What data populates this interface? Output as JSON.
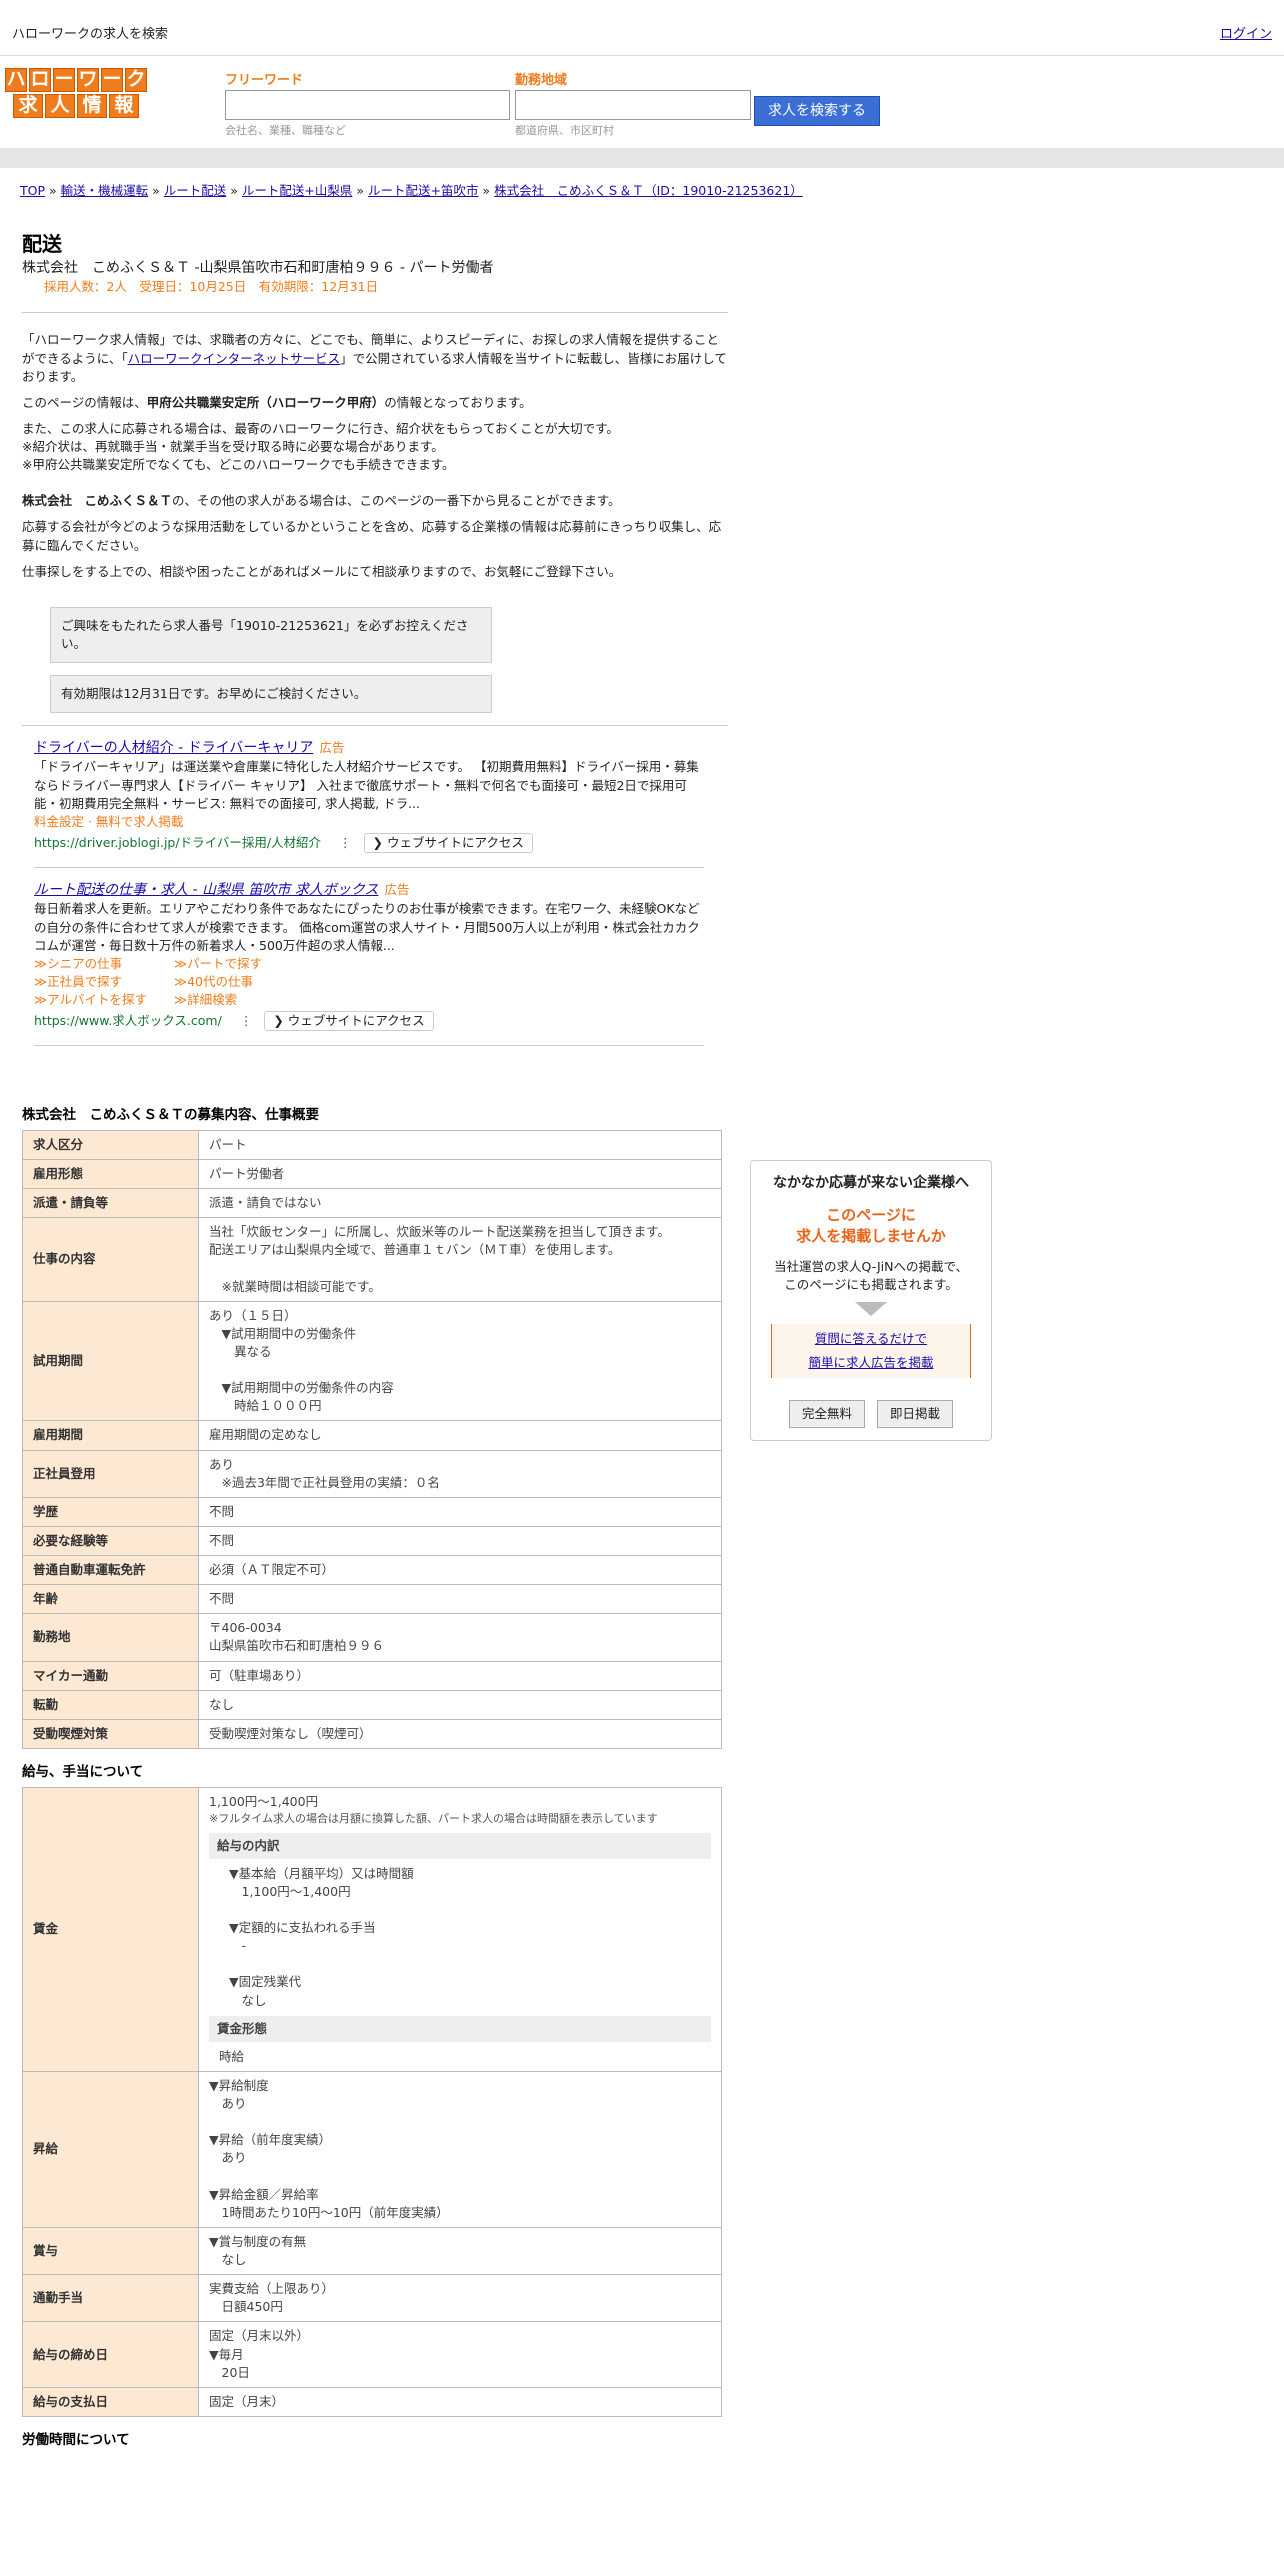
{
  "header": {
    "top_text": "ハローワークの求人を検索",
    "login": "ログイン",
    "logo_row1": [
      "ハ",
      "ロ",
      "ー",
      "ワ",
      "ー",
      "ク"
    ],
    "logo_row2": [
      "求",
      "人",
      "情",
      "報"
    ],
    "free_word_label": "フリーワード",
    "free_word_placeholder": "会社名、業種、職種など",
    "area_label": "勤務地域",
    "area_placeholder": "都道府県、市区町村",
    "search_button": "求人を検索する"
  },
  "breadcrumb": [
    "TOP",
    "輸送・機械運転",
    "ルート配送",
    "ルート配送+山梨県",
    "ルート配送+笛吹市",
    "株式会社　こめふくＳ＆Ｔ（ID：19010-21253621）"
  ],
  "job": {
    "title": "配送",
    "subtitle": "株式会社　こめふくＳ＆Ｔ -山梨県笛吹市石和町唐柏９９６ - パート労働者",
    "meta": "採用人数：2人　受理日：10月25日　有効期限：12月31日"
  },
  "intro": {
    "p1a": "「ハローワーク求人情報」では、求職者の方々に、どこでも、簡単に、よりスピーディに、お探しの求人情報を提供することができるように、「",
    "p1link": "ハローワークインターネットサービス",
    "p1b": "」で公開されている求人情報を当サイトに転載し、皆様にお届けしております。",
    "p2a": "このページの情報は、",
    "p2b": "甲府公共職業安定所（ハローワーク甲府）",
    "p2c": "の情報となっております。",
    "p3": [
      "また、この求人に応募される場合は、最寄のハローワークに行き、紹介状をもらっておくことが大切です。",
      "※紹介状は、再就職手当・就業手当を受け取る時に必要な場合があります。",
      "※甲府公共職業安定所でなくても、どこのハローワークでも手続きできます。"
    ],
    "p4a": "株式会社　こめふくＳ＆Ｔ",
    "p4b": "の、その他の求人がある場合は、このページの一番下から見ることができます。",
    "p5": "応募する会社が今どのような採用活動をしているかということを含め、応募する企業様の情報は応募前にきっちり収集し、応募に臨んでください。",
    "p6": "仕事探しをする上での、相談や困ったことがあればメールにて相談承りますので、お気軽にご登録下さい。",
    "note1": "ご興味をもたれたら求人番号「19010-21253621」を必ずお控えください。",
    "note2": "有効期限は12月31日です。お早めにご検討ください。"
  },
  "ads": [
    {
      "title": "ドライバーの人材紹介 - ドライバーキャリア",
      "tag": "広告",
      "desc": "「ドライバーキャリア」は運送業や倉庫業に特化した人材紹介サービスです。 【初期費用無料】ドライバー採用・募集ならドライバー専門求人【ドライバー キャリア】 入社まで徹底サポート・無料で何名でも面接可・最短2日で採用可能・初期費用完全無料・サービス: 無料での面接可, 求人掲載, ドラ...",
      "extra": "料金設定 · 無料で求人掲載",
      "url": "https://driver.joblogi.jp/ドライバー採用/人材紹介",
      "button": "❯ ウェブサイトにアクセス"
    },
    {
      "title": "ルート配送の仕事・求人 - 山梨県 笛吹市 求人ボックス",
      "tag": "広告",
      "desc": "毎日新着求人を更新。エリアやこだわり条件であなたにぴったりのお仕事が検索できます。在宅ワーク、未経験OKなどの自分の条件に合わせて求人が検索できます。 価格com運営の求人サイト・月間500万人以上が利用・株式会社カカクコムが運営・毎日数十万件の新着求人・500万件超の求人情報...",
      "links": [
        "≫シニアの仕事",
        "≫パートで探す",
        "≫正社員で探す",
        "≫40代の仕事",
        "≫アルバイトを探す",
        "≫詳細検索"
      ],
      "url": "https://www.求人ボックス.com/",
      "button": "❯ ウェブサイトにアクセス"
    }
  ],
  "sections": {
    "overview_title": "株式会社　こめふくＳ＆Ｔの募集内容、仕事概要",
    "overview": [
      {
        "k": "求人区分",
        "v": "パート"
      },
      {
        "k": "雇用形態",
        "v": "パート労働者"
      },
      {
        "k": "派遣・請負等",
        "v": "派遣・請負ではない"
      },
      {
        "k": "仕事の内容",
        "v": "当社「炊飯センター」に所属し、炊飯米等のルート配送業務を担当して頂きます。\n配送エリアは山梨県内全域で、普通車１ｔバン（ＭＴ車）を使用します。\n\n　※就業時間は相談可能です。"
      },
      {
        "k": "試用期間",
        "v": "あり（１５日）\n　▼試用期間中の労働条件\n　　異なる\n\n　▼試用期間中の労働条件の内容\n　　時給１０００円"
      },
      {
        "k": "雇用期間",
        "v": "雇用期間の定めなし"
      },
      {
        "k": "正社員登用",
        "v": "あり\n　※過去3年間で正社員登用の実績：０名"
      },
      {
        "k": "学歴",
        "v": "不問"
      },
      {
        "k": "必要な経験等",
        "v": "不問"
      },
      {
        "k": "普通自動車運転免許",
        "v": "必須（ＡＴ限定不可）"
      },
      {
        "k": "年齢",
        "v": "不問"
      },
      {
        "k": "勤務地",
        "v": "〒406-0034\n山梨県笛吹市石和町唐柏９９６"
      },
      {
        "k": "マイカー通勤",
        "v": "可（駐車場あり）"
      },
      {
        "k": "転勤",
        "v": "なし"
      },
      {
        "k": "受動喫煙対策",
        "v": "受動喫煙対策なし（喫煙可）"
      }
    ],
    "salary_title": "給与、手当について",
    "wage": {
      "k": "賃金",
      "range": "1,100円〜1,400円",
      "note": "※フルタイム求人の場合は月額に換算した額、パート求人の場合は時間額を表示しています",
      "breakdown_title": "給与の内訳",
      "breakdown": "▼基本給（月額平均）又は時間額\n　1,100円〜1,400円\n\n▼定額的に支払われる手当\n　-\n\n▼固定残業代\n　なし",
      "form_title": "賃金形態",
      "form": "時給"
    },
    "salary_rows": [
      {
        "k": "昇給",
        "v": "▼昇給制度\n　あり\n\n▼昇給（前年度実績）\n　あり\n\n▼昇給金額／昇給率\n　1時間あたり10円〜10円（前年度実績）"
      },
      {
        "k": "賞与",
        "v": "▼賞与制度の有無\n　なし"
      },
      {
        "k": "通勤手当",
        "v": "実費支給（上限あり）\n　日額450円"
      },
      {
        "k": "給与の締め日",
        "v": "固定（月末以外）\n▼毎月\n　20日"
      },
      {
        "k": "給与の支払日",
        "v": "固定（月末）"
      }
    ],
    "hours_title": "労働時間について"
  },
  "side": {
    "heading": "なかなか応募が来ない企業様へ",
    "red1": "このページに",
    "red2": "求人を掲載しませんか",
    "desc1": "当社運営の求人Q-JiNへの掲載で、",
    "desc2": "このページにも掲載されます。",
    "link1": "質問に答えるだけで",
    "link2": "簡単に求人広告を掲載",
    "btn1": "完全無料",
    "btn2": "即日掲載"
  }
}
